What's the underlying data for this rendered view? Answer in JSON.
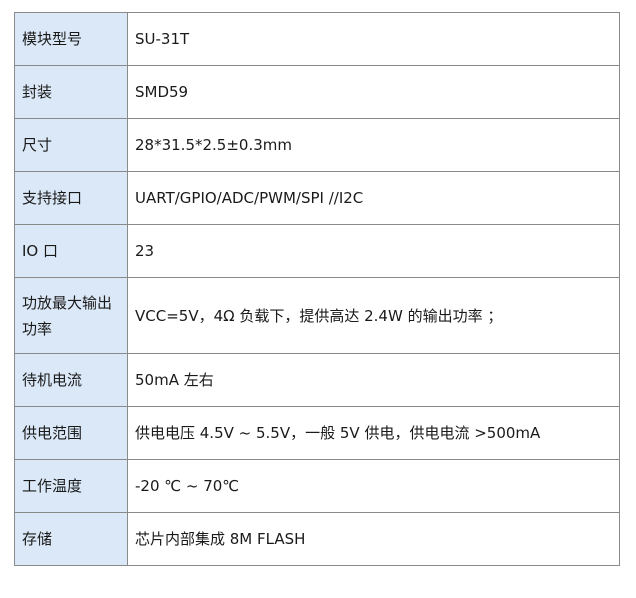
{
  "spec_table": {
    "rows": [
      {
        "label": "模块型号",
        "value": "SU-31T"
      },
      {
        "label": "封装",
        "value": "SMD59"
      },
      {
        "label": "尺寸",
        "value": "28*31.5*2.5±0.3mm"
      },
      {
        "label": "支持接口",
        "value": "UART/GPIO/ADC/PWM/SPI //I2C"
      },
      {
        "label": "IO 口",
        "value": "23"
      },
      {
        "label": "功放最大输出功率",
        "value": "VCC=5V，4Ω 负载下，提供高达 2.4W 的输出功率 ；"
      },
      {
        "label": "待机电流",
        "value": "50mA 左右"
      },
      {
        "label": "供电范围",
        "value": "供电电压 4.5V ~ 5.5V，一般 5V 供电，供电电流 >500mA"
      },
      {
        "label": "工作温度",
        "value": "-20 ℃ ~ 70℃"
      },
      {
        "label": "存储",
        "value": "芯片内部集成 8M FLASH"
      }
    ]
  }
}
